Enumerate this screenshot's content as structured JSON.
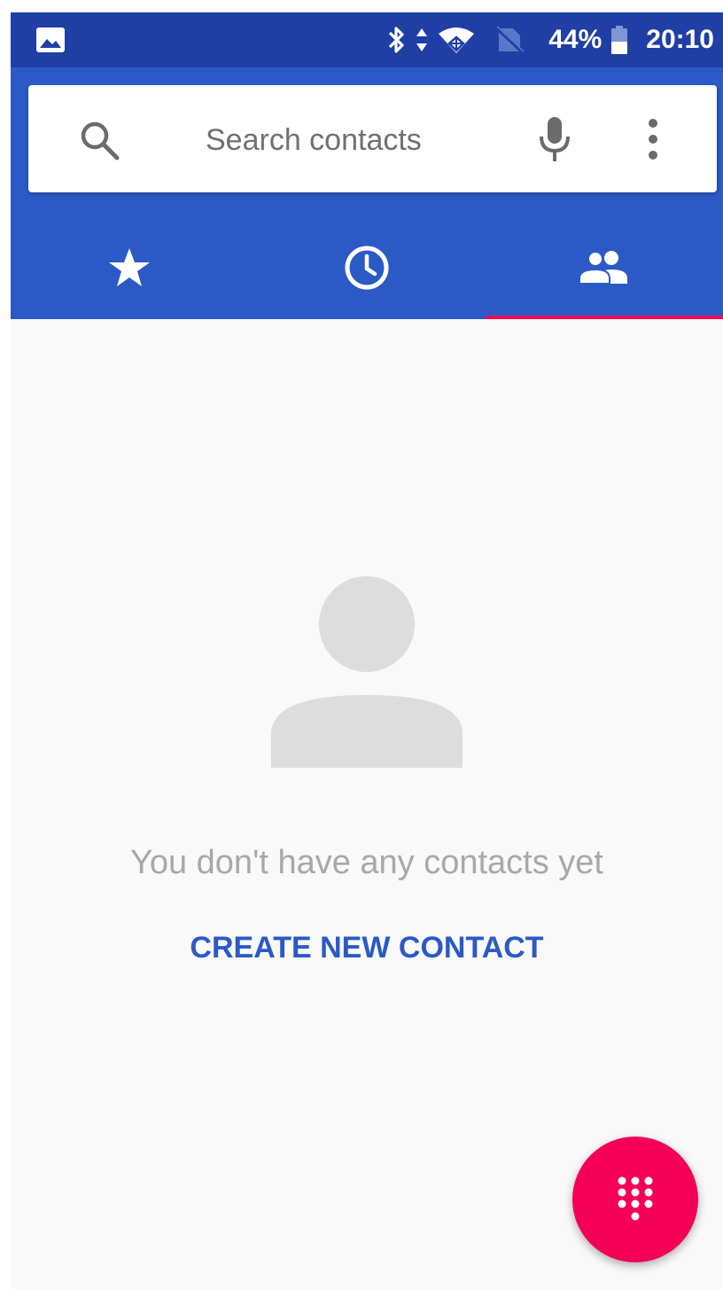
{
  "status_bar": {
    "left_icon": "image-notification-icon",
    "icons": [
      "bluetooth-icon",
      "data-arrows-icon",
      "wifi-icon",
      "no-sim-icon"
    ],
    "battery_percent": "44%",
    "battery_icon": "battery-icon",
    "time": "20:10"
  },
  "search": {
    "placeholder": "Search contacts",
    "search_icon": "search-icon",
    "mic_icon": "mic-icon",
    "more_icon": "more-vert-icon"
  },
  "tabs": [
    {
      "name": "favorites",
      "icon": "star-icon",
      "selected": false
    },
    {
      "name": "recents",
      "icon": "clock-icon",
      "selected": false
    },
    {
      "name": "contacts",
      "icon": "people-icon",
      "selected": true
    }
  ],
  "empty_state": {
    "icon": "person-placeholder-icon",
    "message": "You don't have any contacts yet",
    "action": "CREATE NEW CONTACT"
  },
  "fab": {
    "icon": "dialpad-icon"
  },
  "colors": {
    "status_bar": "#1f3fa5",
    "app_bar": "#2b5ac7",
    "accent": "#f50057",
    "link": "#2b5ac7",
    "empty_text": "#a8a8a8",
    "placeholder_graphic": "#dddddd"
  }
}
